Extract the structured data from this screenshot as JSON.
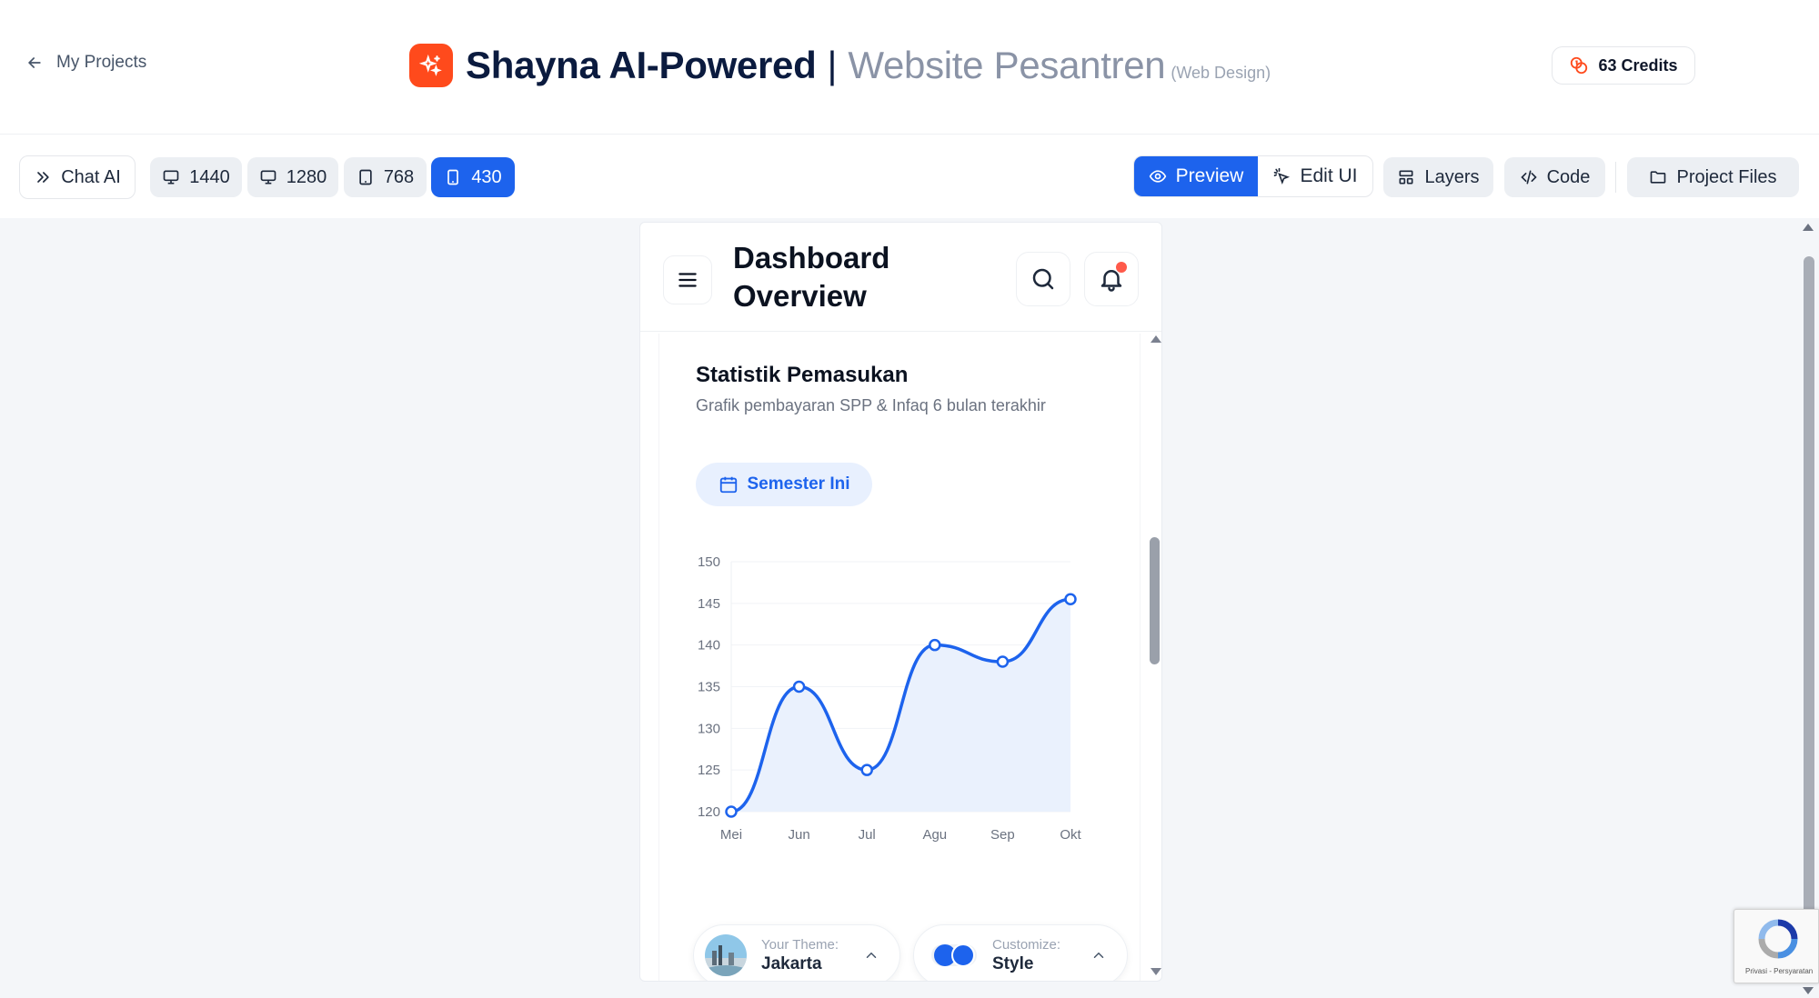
{
  "header": {
    "back_label": "My Projects",
    "title_main": "Shayna AI-Powered",
    "title_separator": "|",
    "title_sub": "Website Pesantren",
    "title_tag": "(Web Design)",
    "credits_label": "63 Credits",
    "logo_color": "#ff4a1c"
  },
  "toolbar": {
    "chat_label": "Chat AI",
    "sizes": [
      "1440",
      "1280",
      "768",
      "430"
    ],
    "active_size": "430",
    "preview_label": "Preview",
    "edit_label": "Edit UI",
    "layers_label": "Layers",
    "code_label": "Code",
    "files_label": "Project Files",
    "accent": "#1d63ed"
  },
  "phone": {
    "page_title": "Dashboard Overview",
    "card": {
      "title": "Statistik Pemasukan",
      "subtitle": "Grafik pembayaran SPP & Infaq 6 bulan terakhir",
      "chip_label": "Semester Ini"
    },
    "theme": {
      "label": "Your Theme:",
      "value": "Jakarta"
    },
    "customize": {
      "label": "Customize:",
      "value": "Style"
    }
  },
  "recaptcha": {
    "text": "Privasi - Persyaratan"
  },
  "chart_data": {
    "type": "area",
    "categories": [
      "Mei",
      "Jun",
      "Jul",
      "Agu",
      "Sep",
      "Okt"
    ],
    "values": [
      120,
      135,
      125,
      140,
      138,
      145.5
    ],
    "yticks": [
      120,
      125,
      130,
      135,
      140,
      145,
      150
    ],
    "ylim": [
      120,
      150
    ],
    "title": "",
    "xlabel": "",
    "ylabel": "",
    "grid": true,
    "line_color": "#1d63ed",
    "fill_color": "#eaf1fd"
  }
}
